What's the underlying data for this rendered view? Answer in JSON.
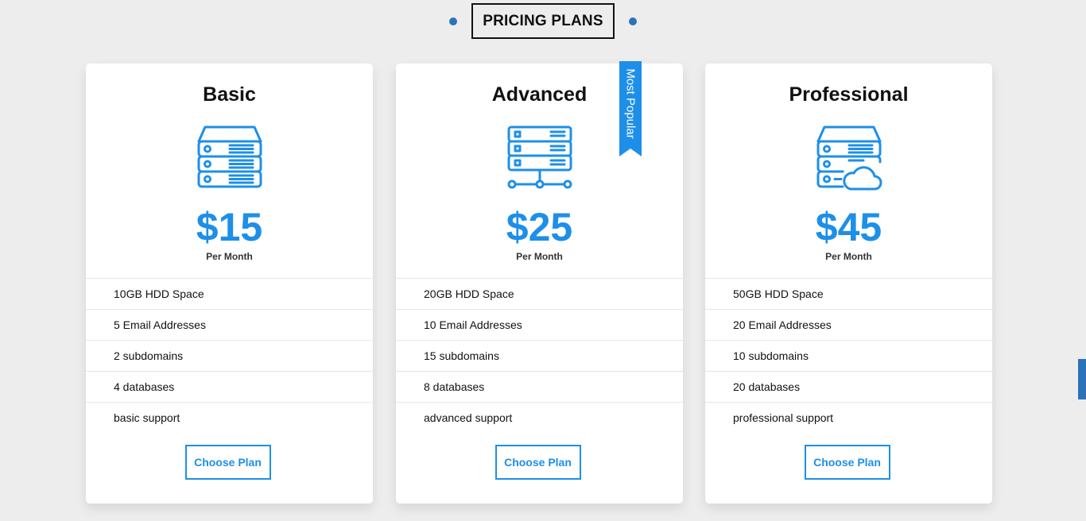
{
  "section": {
    "title": "PRICING PLANS",
    "accent_color": "#2b73b9"
  },
  "brand_color": "#1e8fe8",
  "plans": [
    {
      "name": "Basic",
      "icon": "server-stack-icon",
      "price": "$15",
      "period": "Per Month",
      "features": [
        "10GB HDD Space",
        "5 Email Addresses",
        "2 subdomains",
        "4 databases",
        "basic support"
      ],
      "button_label": "Choose Plan"
    },
    {
      "name": "Advanced",
      "icon": "server-network-icon",
      "price": "$25",
      "period": "Per Month",
      "features": [
        "20GB HDD Space",
        "10 Email Addresses",
        "15 subdomains",
        "8 databases",
        "advanced support"
      ],
      "button_label": "Choose Plan",
      "ribbon": "Most Popular"
    },
    {
      "name": "Professional",
      "icon": "server-cloud-icon",
      "price": "$45",
      "period": "Per Month",
      "features": [
        "50GB HDD Space",
        "20 Email Addresses",
        "10 subdomains",
        "20 databases",
        "professional support"
      ],
      "button_label": "Choose Plan"
    }
  ]
}
